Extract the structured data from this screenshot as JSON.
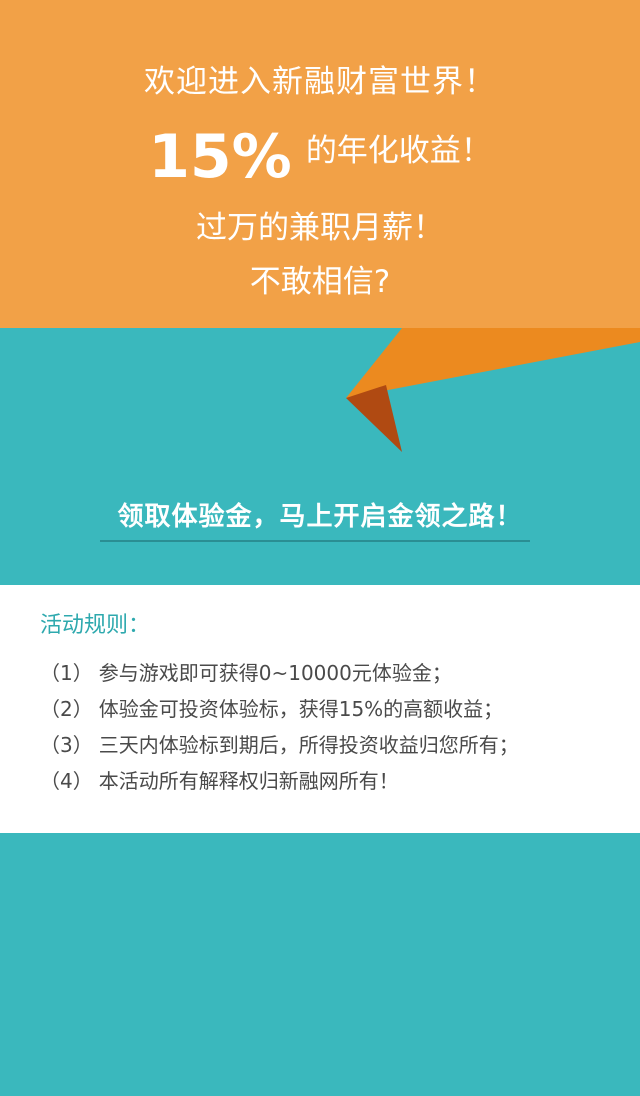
{
  "banner": {
    "line1": "欢迎进入新融财富世界！",
    "line2_big": "15%",
    "line2_rest": "的年化收益！",
    "line3": "过万的兼职月薪！",
    "line4": "不敢相信?"
  },
  "cta": {
    "text": "领取体验金，马上开启金领之路！"
  },
  "rules": {
    "title": "活动规则：",
    "items": [
      {
        "num": "（1）",
        "text": "参与游戏即可获得0~10000元体验金；"
      },
      {
        "num": "（2）",
        "text": "体验金可投资体验标，获得15%的高额收益；"
      },
      {
        "num": "（3）",
        "text": "三天内体验标到期后，所得投资收益归您所有；"
      },
      {
        "num": "（4）",
        "text": "本活动所有解释权归新融网所有！"
      }
    ]
  },
  "colors": {
    "banner_orange": "#f2a147",
    "fold_orange": "#ec8a1f",
    "fold_shadow": "#b04a12",
    "teal_background": "#3ab8bd",
    "rules_title": "#2ea9ae"
  }
}
